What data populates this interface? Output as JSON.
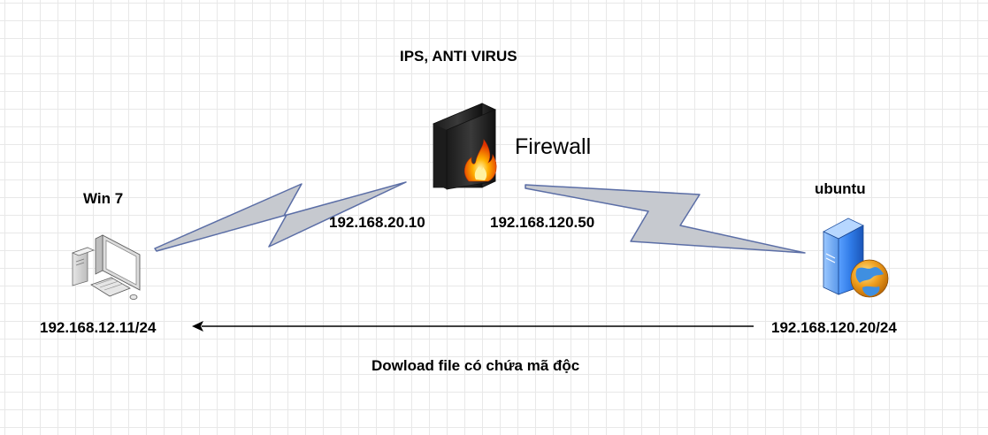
{
  "colors": {
    "link_fill": "#c6c9cf",
    "link_stroke": "#5b6ea6",
    "arrow": "#000000",
    "grid": "#e8e8e8"
  },
  "nodes": {
    "firewall": {
      "top_label": "IPS, ANTI VIRUS",
      "name": "Firewall",
      "left_ip": "192.168.20.10",
      "right_ip": "192.168.120.50",
      "icon": "firewall-icon"
    },
    "client": {
      "name": "Win 7",
      "ip": "192.168.12.11/24",
      "icon": "computer-icon"
    },
    "server": {
      "name": "ubuntu",
      "ip": "192.168.120.20/24",
      "icon": "web-server-icon"
    }
  },
  "flow": {
    "label": "Dowload file có chứa mã độc",
    "direction": "from server to client"
  }
}
